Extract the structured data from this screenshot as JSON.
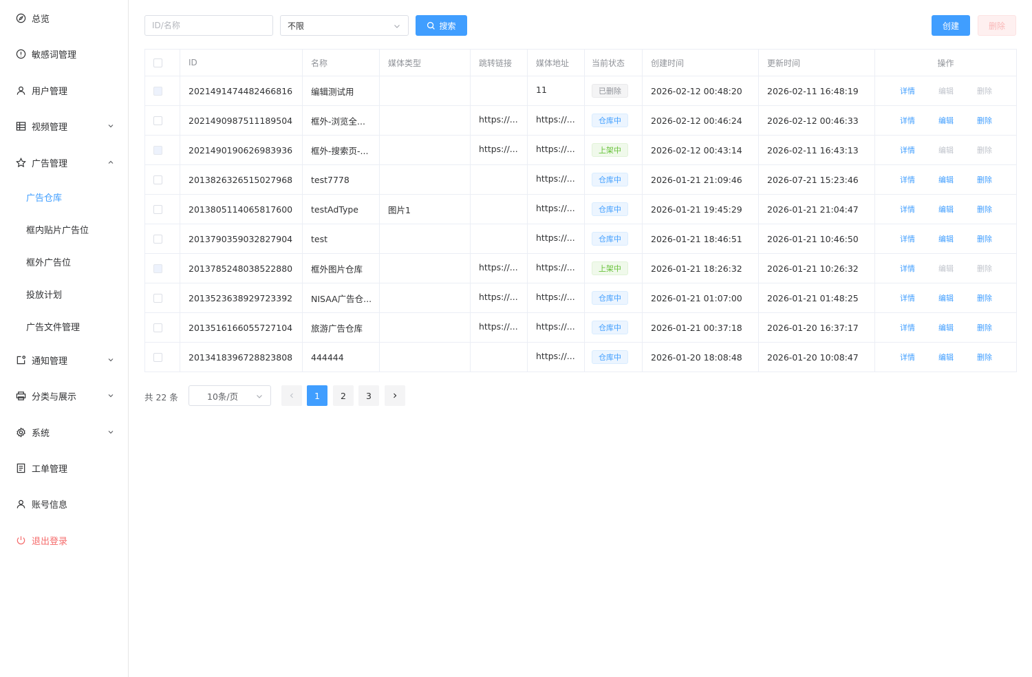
{
  "sidebar": {
    "items": [
      {
        "label": "总览",
        "icon": "compass-icon"
      },
      {
        "label": "敏感词管理",
        "icon": "warning-circle-icon"
      },
      {
        "label": "用户管理",
        "icon": "user-icon"
      },
      {
        "label": "视频管理",
        "icon": "grid-icon"
      },
      {
        "label": "广告管理",
        "icon": "star-icon"
      },
      {
        "label": "通知管理",
        "icon": "notification-icon"
      },
      {
        "label": "分类与展示",
        "icon": "printer-icon"
      },
      {
        "label": "系统",
        "icon": "gear-icon"
      },
      {
        "label": "工单管理",
        "icon": "document-icon"
      },
      {
        "label": "账号信息",
        "icon": "user-icon"
      },
      {
        "label": "退出登录",
        "icon": "power-icon"
      }
    ],
    "ad_subitems": [
      "广告仓库",
      "框内贴片广告位",
      "框外广告位",
      "投放计划",
      "广告文件管理"
    ],
    "active_subitem": "广告仓库"
  },
  "toolbar": {
    "search_placeholder": "ID/名称",
    "status_value": "不限",
    "search_label": "搜索",
    "create_label": "创建",
    "delete_label": "删除"
  },
  "table": {
    "headers": {
      "id": "ID",
      "name": "名称",
      "media_type": "媒体类型",
      "jump_link": "跳转链接",
      "media_url": "媒体地址",
      "state": "当前状态",
      "created": "创建时间",
      "updated": "更新时间",
      "ops": "操作"
    },
    "op_labels": {
      "detail": "详情",
      "edit": "编辑",
      "delete": "删除"
    },
    "rows": [
      {
        "id": "2021491474482466816",
        "name": "编辑测试用",
        "media_type": "",
        "jump_link": "",
        "media_url": "11",
        "state": "已删除",
        "state_kind": "deleted",
        "created": "2026-02-12 00:48:20",
        "updated": "2026-02-11 16:48:19",
        "editable": false,
        "checkbox_disabled": true
      },
      {
        "id": "2021490987511189504",
        "name": "框外-浏览全...",
        "media_type": "",
        "jump_link": "https://...",
        "media_url": "https://...",
        "state": "仓库中",
        "state_kind": "stored",
        "created": "2026-02-12 00:46:24",
        "updated": "2026-02-12 00:46:33",
        "editable": true,
        "checkbox_disabled": false
      },
      {
        "id": "2021490190626983936",
        "name": "框外-搜索页-...",
        "media_type": "",
        "jump_link": "https://...",
        "media_url": "https://...",
        "state": "上架中",
        "state_kind": "online",
        "created": "2026-02-12 00:43:14",
        "updated": "2026-02-11 16:43:13",
        "editable": false,
        "checkbox_disabled": true
      },
      {
        "id": "2013826326515027968",
        "name": "test7778",
        "media_type": "",
        "jump_link": "",
        "media_url": "https://...",
        "state": "仓库中",
        "state_kind": "stored",
        "created": "2026-01-21 21:09:46",
        "updated": "2026-07-21 15:23:46",
        "editable": true,
        "checkbox_disabled": false
      },
      {
        "id": "2013805114065817600",
        "name": "testAdType",
        "media_type": "图片1",
        "jump_link": "",
        "media_url": "https://...",
        "state": "仓库中",
        "state_kind": "stored",
        "created": "2026-01-21 19:45:29",
        "updated": "2026-01-21 21:04:47",
        "editable": true,
        "checkbox_disabled": false
      },
      {
        "id": "2013790359032827904",
        "name": "test",
        "media_type": "",
        "jump_link": "",
        "media_url": "https://...",
        "state": "仓库中",
        "state_kind": "stored",
        "created": "2026-01-21 18:46:51",
        "updated": "2026-01-21 10:46:50",
        "editable": true,
        "checkbox_disabled": false
      },
      {
        "id": "2013785248038522880",
        "name": "框外图片仓库",
        "media_type": "",
        "jump_link": "https://...",
        "media_url": "https://...",
        "state": "上架中",
        "state_kind": "online",
        "created": "2026-01-21 18:26:32",
        "updated": "2026-01-21 10:26:32",
        "editable": false,
        "checkbox_disabled": true
      },
      {
        "id": "2013523638929723392",
        "name": "NISAA广告仓...",
        "media_type": "",
        "jump_link": "https://...",
        "media_url": "https://...",
        "state": "仓库中",
        "state_kind": "stored",
        "created": "2026-01-21 01:07:00",
        "updated": "2026-01-21 01:48:25",
        "editable": true,
        "checkbox_disabled": false
      },
      {
        "id": "2013516166055727104",
        "name": "旅游广告仓库",
        "media_type": "",
        "jump_link": "https://...",
        "media_url": "https://...",
        "state": "仓库中",
        "state_kind": "stored",
        "created": "2026-01-21 00:37:18",
        "updated": "2026-01-20 16:37:17",
        "editable": true,
        "checkbox_disabled": false
      },
      {
        "id": "2013418396728823808",
        "name": "444444",
        "media_type": "",
        "jump_link": "",
        "media_url": "https://...",
        "state": "仓库中",
        "state_kind": "stored",
        "created": "2026-01-20 18:08:48",
        "updated": "2026-01-20 10:08:47",
        "editable": true,
        "checkbox_disabled": false
      }
    ]
  },
  "pagination": {
    "total_label": "共 22 条",
    "page_size": "10条/页",
    "pages": [
      "1",
      "2",
      "3"
    ],
    "current_page": "1"
  },
  "colors": {
    "primary": "#409eff",
    "danger": "#f56c6c",
    "success": "#67c23a"
  }
}
